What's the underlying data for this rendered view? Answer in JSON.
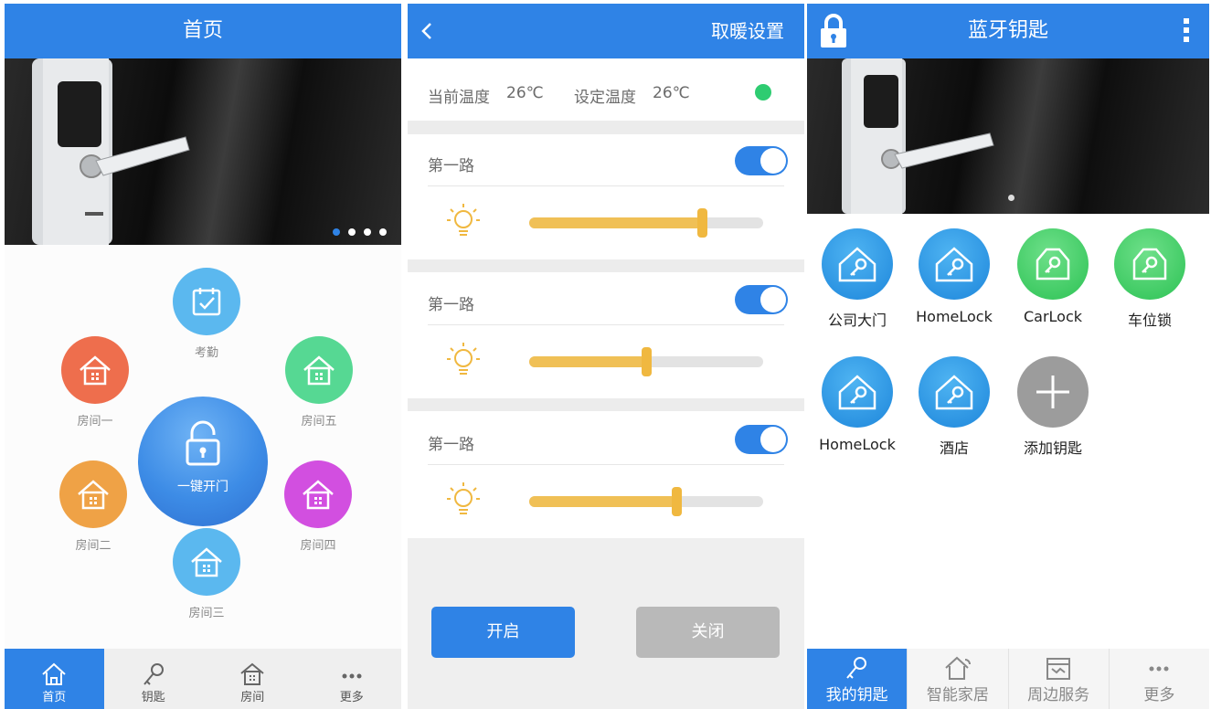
{
  "screen1": {
    "title": "首页",
    "center_button": "一键开门",
    "items": [
      {
        "label": "考勤",
        "color": "#5bb8ef"
      },
      {
        "label": "房间一",
        "color": "#ee6e4d"
      },
      {
        "label": "房间五",
        "color": "#56d893"
      },
      {
        "label": "房间二",
        "color": "#efa246"
      },
      {
        "label": "房间四",
        "color": "#d24fe0"
      },
      {
        "label": "房间三",
        "color": "#5bb8ef"
      }
    ],
    "tabs": [
      "首页",
      "钥匙",
      "房间",
      "更多"
    ]
  },
  "screen2": {
    "title": "取暖设置",
    "current_temp_label": "当前温度",
    "current_temp": "26℃",
    "set_temp_label": "设定温度",
    "set_temp": "26℃",
    "status_color": "#2ecc71",
    "circuits": [
      {
        "label": "第一路",
        "on": true,
        "level": 0.74
      },
      {
        "label": "第一路",
        "on": true,
        "level": 0.5
      },
      {
        "label": "第一路",
        "on": true,
        "level": 0.63
      }
    ],
    "open_label": "开启",
    "close_label": "关闭"
  },
  "screen3": {
    "title": "蓝牙钥匙",
    "keys": [
      {
        "label": "公司大门",
        "type": "home"
      },
      {
        "label": "HomeLock",
        "type": "home"
      },
      {
        "label": "CarLock",
        "type": "car"
      },
      {
        "label": "车位锁",
        "type": "car"
      },
      {
        "label": "HomeLock",
        "type": "home"
      },
      {
        "label": "酒店",
        "type": "home"
      },
      {
        "label": "添加钥匙",
        "type": "add"
      }
    ],
    "tabs": [
      "我的钥匙",
      "智能家居",
      "周边服务",
      "更多"
    ]
  },
  "colors": {
    "accent": "#2f83e6",
    "slider": "#f0c056",
    "inactive_button": "#b9b9b9"
  }
}
